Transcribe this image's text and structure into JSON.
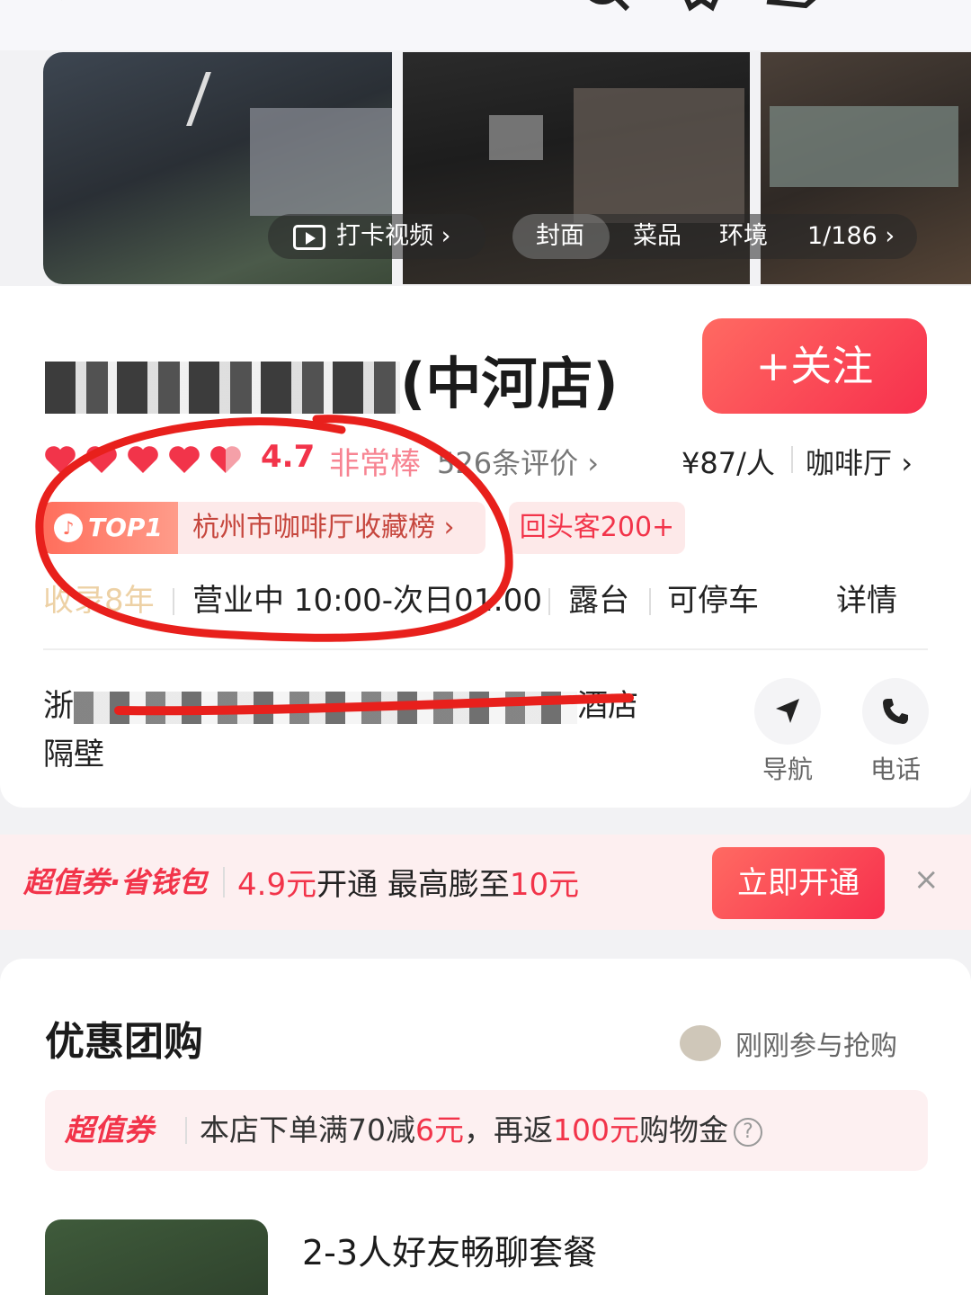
{
  "gallery": {
    "video_label": "打卡视频",
    "tabs": [
      "封面",
      "菜品",
      "环境"
    ],
    "counter": "1/186"
  },
  "shop": {
    "name_suffix": "(中河店)",
    "follow_label": "+关注",
    "hearts": 5,
    "score": "4.7",
    "score_desc": "非常棒",
    "reviews": "526条评价",
    "price": "¥87/人",
    "category": "咖啡厅",
    "rank_prefix": "TOP1",
    "rank_label": "杭州市咖啡厅收藏榜",
    "repeat_label": "回头客200+",
    "years": "收录8年",
    "hours": "营业中 10:00-次日01:00",
    "tag1": "露台",
    "tag2": "可停车",
    "details": "详情",
    "addr_start": "浙",
    "addr_end": "酒店",
    "addr_line2": "隔壁",
    "nav_label": "导航",
    "phone_label": "电话"
  },
  "promo": {
    "brand": "超值券·省钱包",
    "text_red1": "4.9元",
    "text_mid": "开通 最高膨至",
    "text_red2": "10元",
    "button": "立即开通",
    "close": "×"
  },
  "deals": {
    "title": "优惠团购",
    "buyers": "刚刚参与抢购",
    "coupon_brand": "超值券",
    "coupon_text1": "本店下单满70减",
    "coupon_red1": "6元",
    "coupon_text2": "，再返",
    "coupon_red2": "100元",
    "coupon_text3": "购物金",
    "item_name": "2-3人好友畅聊套餐"
  },
  "colors": {
    "accent": "#f2344a",
    "annotation": "#e8201c"
  },
  "icons": [
    "back-icon",
    "search-icon",
    "star-icon",
    "share-icon",
    "play-icon",
    "navigation-icon",
    "phone-icon",
    "close-icon",
    "help-icon",
    "heart-icon"
  ]
}
